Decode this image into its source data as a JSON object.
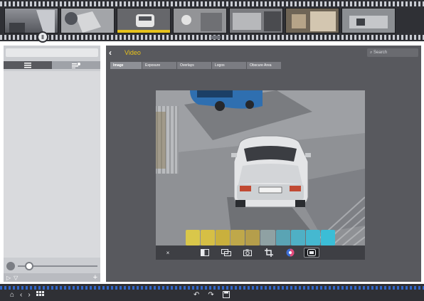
{
  "filmstrip": {
    "thumbnails": [
      {
        "label": "",
        "bg": "#6e7078",
        "active": false
      },
      {
        "label": "",
        "bg": "#9a9b9f",
        "active": false
      },
      {
        "label": "",
        "bg": "#6b6c70",
        "active": true
      },
      {
        "label": "",
        "bg": "#8e8f92",
        "active": false
      },
      {
        "label": "",
        "bg": "#77787c",
        "active": false
      },
      {
        "label": "",
        "bg": "#6a5e4e",
        "active": false
      },
      {
        "label": "",
        "bg": "#8c8f93",
        "active": false
      }
    ]
  },
  "sidebar": {
    "search_placeholder": "",
    "tab_list_icon": "list-icon",
    "tab_filter_icon": "filter-sort-icon",
    "slider_min_label": "",
    "bottom_play_icon": "▷",
    "bottom_filter_icon": "▽",
    "bottom_add_icon": "+"
  },
  "main": {
    "back_icon": "‹",
    "title": "Video",
    "search_label": "Search",
    "tabs": [
      "Image",
      "Exposure",
      "Overlays",
      "Logos",
      "Obscure Area"
    ]
  },
  "viewer": {
    "plate_text": "",
    "tools": {
      "close": "×",
      "layout_icon": "layout-icon",
      "crop_compare_icon": "compare-icon",
      "snapshot_icon": "camera-icon",
      "crop_icon": "crop-icon",
      "color_icon": "color-adjust-icon",
      "selected_icon": "overlay-icon"
    },
    "filter_colors": [
      "#d9c74a",
      "#d6bf45",
      "#c9b03d",
      "#bfa84a",
      "#b59e4b",
      "#8fa1a3",
      "#5aa4b4",
      "#4fb0c5",
      "#45b8d0",
      "#3bbdd6"
    ]
  },
  "bottom": {
    "home_icon": "⌂",
    "prev_icon": "‹",
    "next_icon": "›",
    "grid_icon": "grid-icon",
    "undo_icon": "↶",
    "redo_icon": "↷",
    "save_icon": "save-icon"
  },
  "colors": {
    "accent": "#e8c21a",
    "panel": "#58595e",
    "strip": "#2f3035",
    "bottom_perf": "#2f66c9"
  }
}
